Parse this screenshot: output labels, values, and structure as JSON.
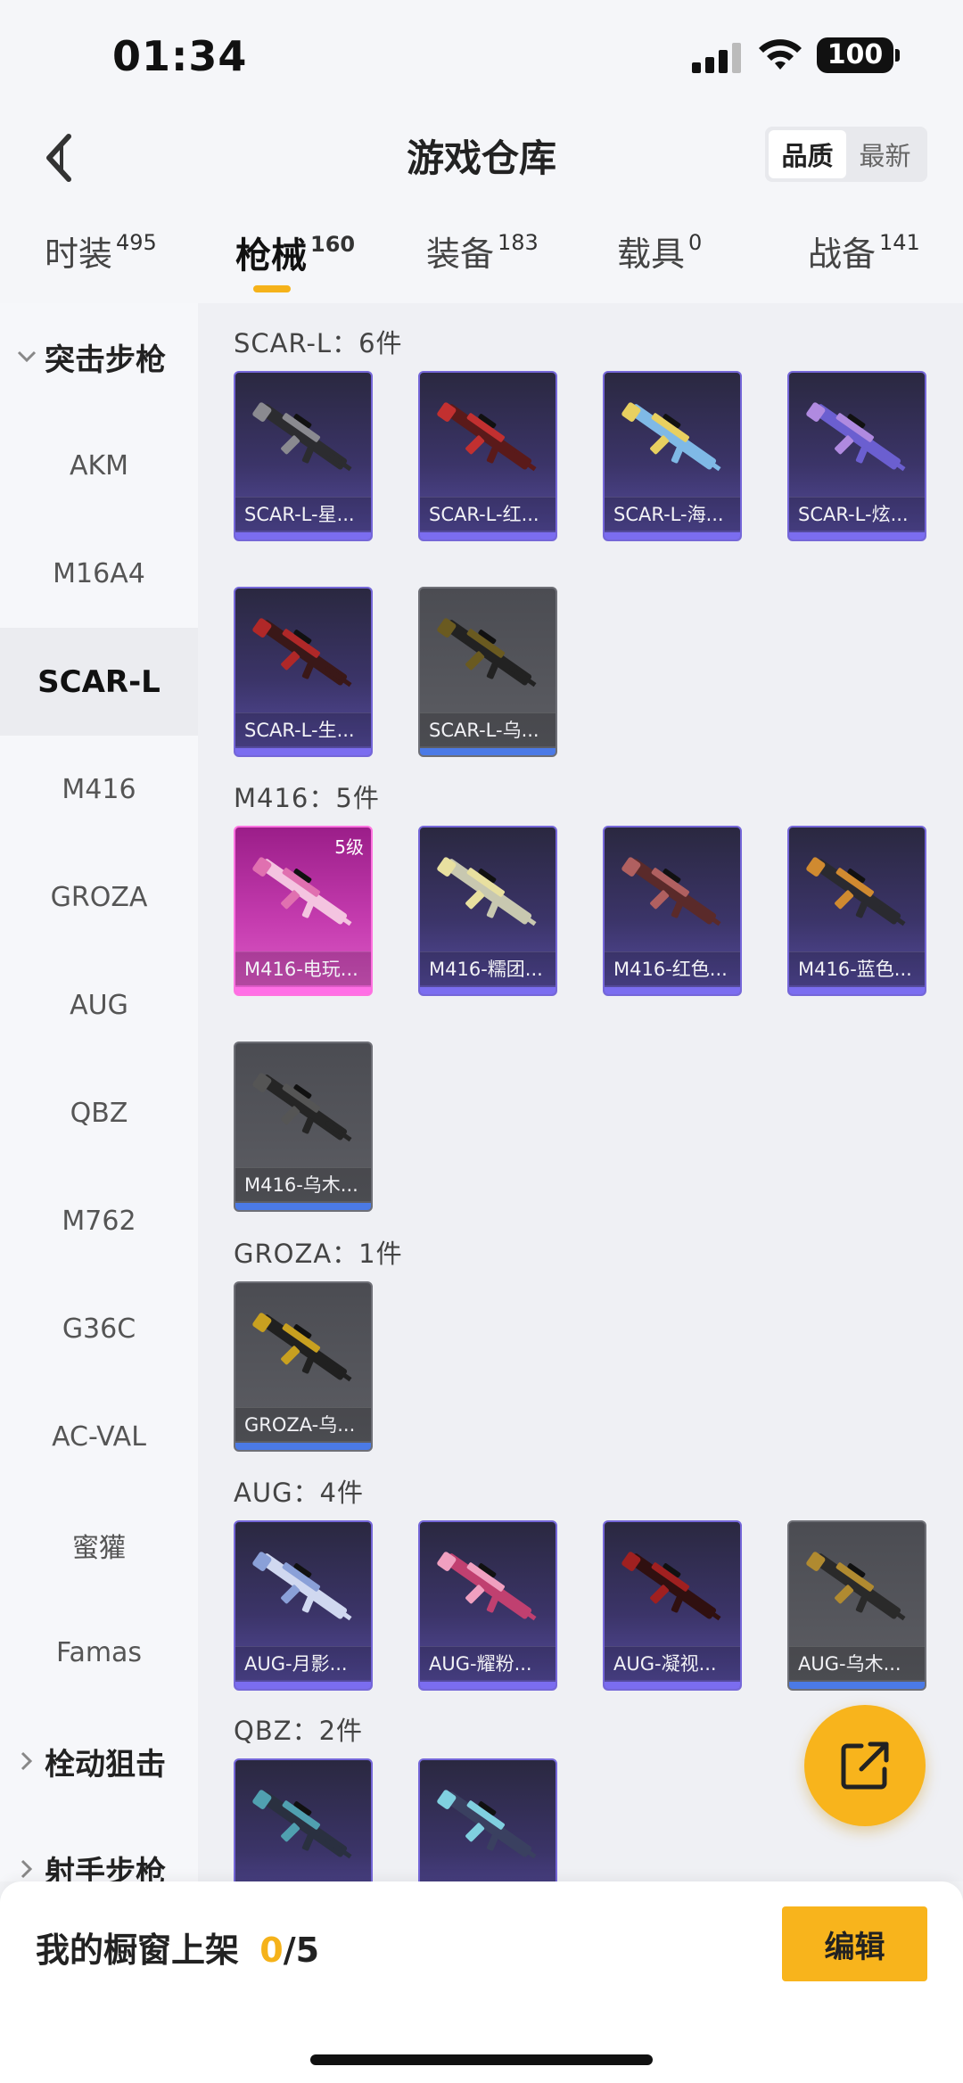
{
  "status_bar": {
    "time": "01:34",
    "battery": "100"
  },
  "header": {
    "title": "游戏仓库",
    "sort_options": [
      "品质",
      "最新"
    ]
  },
  "tabs": [
    {
      "label": "时装",
      "count": "495"
    },
    {
      "label": "枪械",
      "count": "160"
    },
    {
      "label": "装备",
      "count": "183"
    },
    {
      "label": "载具",
      "count": "0"
    },
    {
      "label": "战备",
      "count": "141"
    }
  ],
  "sidebar": {
    "group_assault": "突击步枪",
    "items": [
      "AKM",
      "M16A4",
      "SCAR-L",
      "M416",
      "GROZA",
      "AUG",
      "QBZ",
      "M762",
      "G36C",
      "AC-VAL",
      "蜜獾",
      "Famas"
    ],
    "active_item": "SCAR-L",
    "group_bolt": "栓动狙击",
    "group_marksman": "射手步枪"
  },
  "sections": [
    {
      "title": "SCAR-L：6件",
      "items": [
        {
          "label": "SCAR-L-星...",
          "rarity": "purple",
          "level": ""
        },
        {
          "label": "SCAR-L-红...",
          "rarity": "purple",
          "level": ""
        },
        {
          "label": "SCAR-L-海...",
          "rarity": "purple",
          "level": ""
        },
        {
          "label": "SCAR-L-炫...",
          "rarity": "purple",
          "level": ""
        },
        {
          "label": "SCAR-L-生...",
          "rarity": "purple",
          "level": ""
        },
        {
          "label": "SCAR-L-乌...",
          "rarity": "gray",
          "level": ""
        }
      ]
    },
    {
      "title": "M416：5件",
      "items": [
        {
          "label": "M416-电玩...",
          "rarity": "pink",
          "level": "5级"
        },
        {
          "label": "M416-糯团...",
          "rarity": "purple",
          "level": ""
        },
        {
          "label": "M416-红色...",
          "rarity": "purple",
          "level": ""
        },
        {
          "label": "M416-蓝色...",
          "rarity": "purple",
          "level": ""
        },
        {
          "label": "M416-乌木...",
          "rarity": "gray",
          "level": ""
        }
      ]
    },
    {
      "title": "GROZA：1件",
      "items": [
        {
          "label": "GROZA-乌...",
          "rarity": "gray",
          "level": ""
        }
      ]
    },
    {
      "title": "AUG：4件",
      "items": [
        {
          "label": "AUG-月影...",
          "rarity": "purple",
          "level": ""
        },
        {
          "label": "AUG-耀粉...",
          "rarity": "purple",
          "level": ""
        },
        {
          "label": "AUG-凝视...",
          "rarity": "purple",
          "level": ""
        },
        {
          "label": "AUG-乌木...",
          "rarity": "gray",
          "level": ""
        }
      ]
    },
    {
      "title": "QBZ：2件",
      "items": [
        {
          "label": "",
          "rarity": "purple",
          "level": ""
        },
        {
          "label": "",
          "rarity": "purple",
          "level": ""
        }
      ]
    }
  ],
  "gun_colors": [
    [
      "#2c2c30",
      "#8a8a90"
    ],
    [
      "#5a1a1a",
      "#c23030"
    ],
    [
      "#7fb9e6",
      "#e8d060"
    ],
    [
      "#6b5fd0",
      "#b08ae0"
    ],
    [
      "#3a1818",
      "#b02828"
    ],
    [
      "#222222",
      "#6a5a20"
    ],
    [
      "#f4c4e0",
      "#e070b0"
    ],
    [
      "#c8c8b0",
      "#e8e0a0"
    ],
    [
      "#5a2a2a",
      "#b06060"
    ],
    [
      "#2a2a30",
      "#d08a30"
    ],
    [
      "#252525",
      "#555555"
    ],
    [
      "#202020",
      "#c8a020"
    ],
    [
      "#d0d8f0",
      "#8aa0d8"
    ],
    [
      "#c04070",
      "#f0a0c0"
    ],
    [
      "#301010",
      "#a02020"
    ],
    [
      "#2a2a2a",
      "#b08a30"
    ],
    [
      "#2a3040",
      "#50a0b0"
    ],
    [
      "#3a4060",
      "#80d0e0"
    ]
  ],
  "showcase": {
    "label": "我的橱窗上架",
    "count": "0",
    "total": "/5"
  },
  "edit_button": "编辑",
  "colors": {
    "accent": "#f8b41c",
    "purple_rarity": "#7567d8",
    "pink_rarity": "#ff73e0",
    "gray_rarity": "#4b7ae6"
  }
}
